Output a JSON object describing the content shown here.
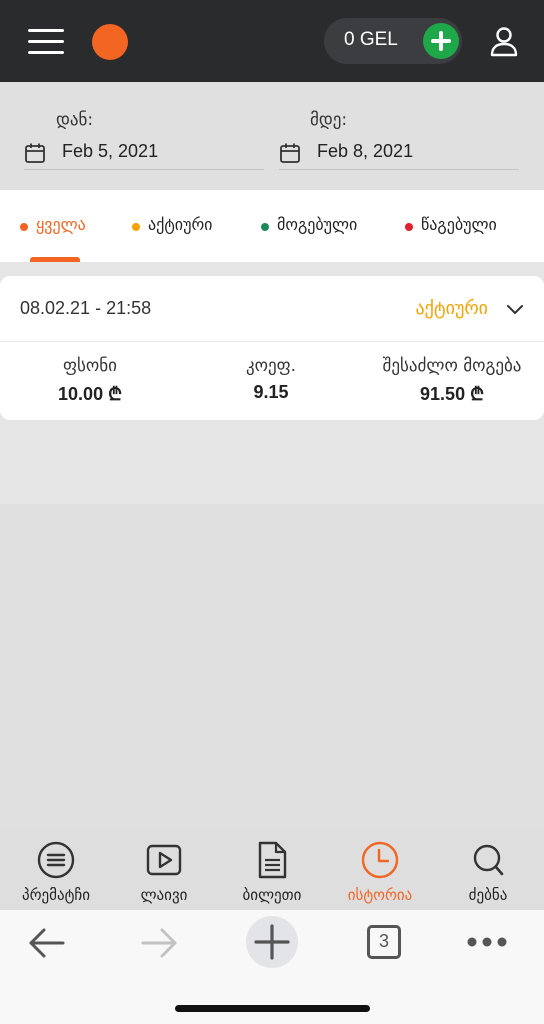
{
  "header": {
    "balance": "0 GEL",
    "colors": {
      "bar": "#2a2b2d",
      "logo": "#f26522",
      "add": "#1ea84a"
    }
  },
  "filters": {
    "from_label": "დან:",
    "from_value": "Feb 5, 2021",
    "to_label": "მდე:",
    "to_value": "Feb 8, 2021"
  },
  "tabs": [
    {
      "label": "ყველა",
      "color": "#f26522",
      "active": true
    },
    {
      "label": "აქტიური",
      "color": "#f5a100",
      "active": false
    },
    {
      "label": "მოგებული",
      "color": "#1b8a5a",
      "active": false
    },
    {
      "label": "წაგებული",
      "color": "#e0202a",
      "active": false
    }
  ],
  "bet": {
    "datetime": "08.02.21 - 21:58",
    "status": "აქტიური",
    "columns": [
      {
        "label": "ფსონი",
        "value": "10.00 ₾"
      },
      {
        "label": "კოეფ.",
        "value": "9.15"
      },
      {
        "label": "შესაძლო მოგება",
        "value": "91.50 ₾"
      }
    ]
  },
  "bottom_nav": [
    {
      "label": "პრემატჩი",
      "icon": "prematch-icon",
      "active": false
    },
    {
      "label": "ლაივი",
      "icon": "live-play-icon",
      "active": false
    },
    {
      "label": "ბილეთი",
      "icon": "ticket-document-icon",
      "active": false
    },
    {
      "label": "ისტორია",
      "icon": "history-clock-icon",
      "active": true
    },
    {
      "label": "ძებნა",
      "icon": "search-icon",
      "active": false
    }
  ],
  "browser": {
    "tab_count": "3"
  }
}
